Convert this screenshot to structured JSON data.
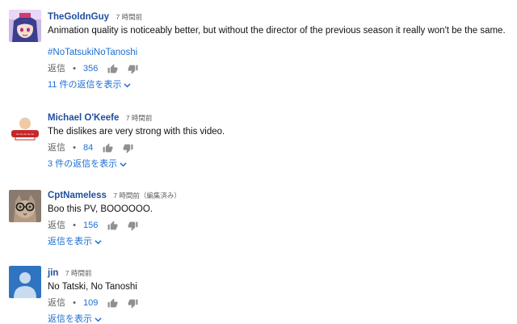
{
  "labels": {
    "reply": "返信",
    "separator": "•"
  },
  "comments": [
    {
      "author": "TheGoldnGuy",
      "timestamp": "7 時間前",
      "text": "Animation quality is noticeably better, but without the director of the previous season it really won't  be the same.",
      "hashtag": "#NoTatsukiNoTanoshi",
      "likes": "356",
      "replies_label": "11 件の返信を表示",
      "avatar": "anime-girl-avatar"
    },
    {
      "author": "Michael O'Keefe",
      "timestamp": "7 時間前",
      "text": "The dislikes are very strong with this video.",
      "likes": "84",
      "replies_label": "3 件の返信を表示",
      "avatar": "budweiser-logo-avatar"
    },
    {
      "author": "CptNameless",
      "timestamp": "7 時間前（編集済み）",
      "text": "Boo this PV, BOOOOOO.",
      "likes": "156",
      "replies_label": "返信を表示",
      "avatar": "cat-with-glasses-avatar"
    },
    {
      "author": "jin",
      "timestamp": "7 時間前",
      "text": "No Tatski, No Tanoshi",
      "likes": "109",
      "replies_label": "返信を表示",
      "avatar": "default-user-avatar"
    }
  ],
  "colors": {
    "author": "#1f4e9e",
    "link": "#1d6fd1",
    "meta": "#606060",
    "default_avatar_bg": "#2f74c0"
  }
}
